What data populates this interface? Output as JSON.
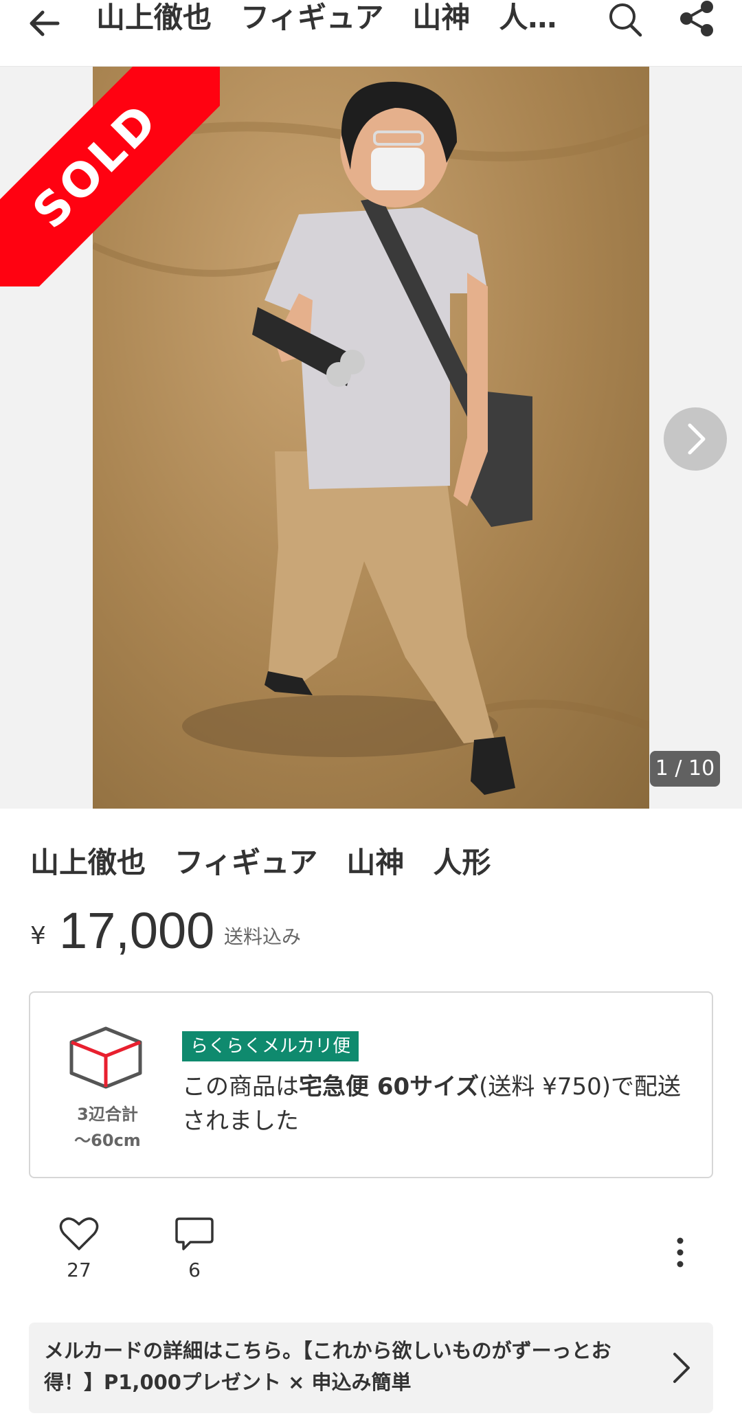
{
  "header": {
    "title": "山上徹也　フィギュア　山神　人…",
    "back_icon": "back-arrow-icon",
    "search_icon": "search-icon",
    "share_icon": "share-icon"
  },
  "gallery": {
    "sold_label": "SOLD",
    "counter": "1 / 10",
    "current_image": 1,
    "total_images": 10
  },
  "item": {
    "title": "山上徹也　フィギュア　山神　人形",
    "price_currency": "¥",
    "price": "17,000",
    "shipping_note": "送料込み"
  },
  "shipping": {
    "badge": "らくらくメルカリ便",
    "size_line1": "3辺合計",
    "size_line2": "〜60cm",
    "desc_pre": "この商品は",
    "desc_bold": "宅急便 60サイズ",
    "desc_post": "(送料 ¥750)で配送されました"
  },
  "actions": {
    "likes": "27",
    "comments": "6"
  },
  "promo": {
    "text": "メルカードの詳細はこちら。【これから欲しいものがずーっとお得！】P1,000プレゼント × 申込み簡単"
  },
  "colors": {
    "sold_red": "#ff0211",
    "badge_green": "#0f8a6e"
  }
}
